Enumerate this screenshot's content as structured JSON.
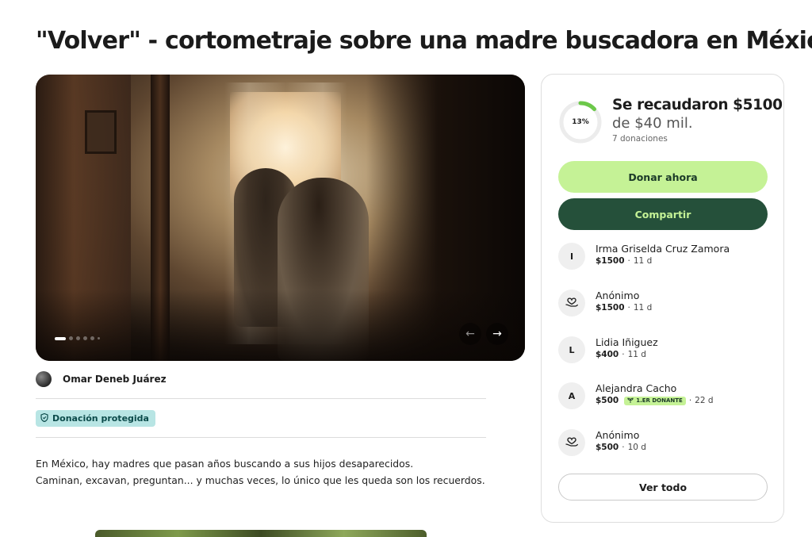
{
  "title": "\"Volver\" - cortometraje sobre una madre buscadora en México",
  "hero": {
    "slide_count": 6,
    "active_slide": 1,
    "prev_icon": "arrow-left-icon",
    "next_icon": "arrow-right-icon"
  },
  "organizer": {
    "name": "Omar Deneb Juárez"
  },
  "badge": {
    "label": "Donación protegida",
    "icon": "shield-icon",
    "color": "#b8e5e4"
  },
  "story": {
    "line1": "En México, hay madres que pasan años buscando a sus hijos desaparecidos.",
    "line2": "Caminan, excavan, preguntan... y muchas veces, lo único que les queda son los recuerdos."
  },
  "donation": {
    "percent_label": "13%",
    "progress": 0.13,
    "raised": "Se recaudaron $5100",
    "goal": "de $40 mil.",
    "count": "7 donaciones",
    "donate_label": "Donar ahora",
    "share_label": "Compartir",
    "view_all_label": "Ver todo",
    "colors": {
      "accent": "#c5f296",
      "dark": "#25503a",
      "progress": "#6cc84a"
    },
    "donors": [
      {
        "initial": "I",
        "icon": null,
        "name": "Irma Griselda Cruz Zamora",
        "amount": "$1500",
        "time": "11 d",
        "badge": ""
      },
      {
        "initial": "",
        "icon": "heart-hand-icon",
        "name": "Anónimo",
        "amount": "$1500",
        "time": "11 d",
        "badge": ""
      },
      {
        "initial": "L",
        "icon": null,
        "name": "Lidia Iñiguez",
        "amount": "$400",
        "time": "11 d",
        "badge": ""
      },
      {
        "initial": "A",
        "icon": null,
        "name": "Alejandra Cacho",
        "amount": "$500",
        "time": "22 d",
        "badge": "1.ER DONANTE"
      },
      {
        "initial": "",
        "icon": "heart-hand-icon",
        "name": "Anónimo",
        "amount": "$500",
        "time": "10 d",
        "badge": ""
      }
    ]
  }
}
